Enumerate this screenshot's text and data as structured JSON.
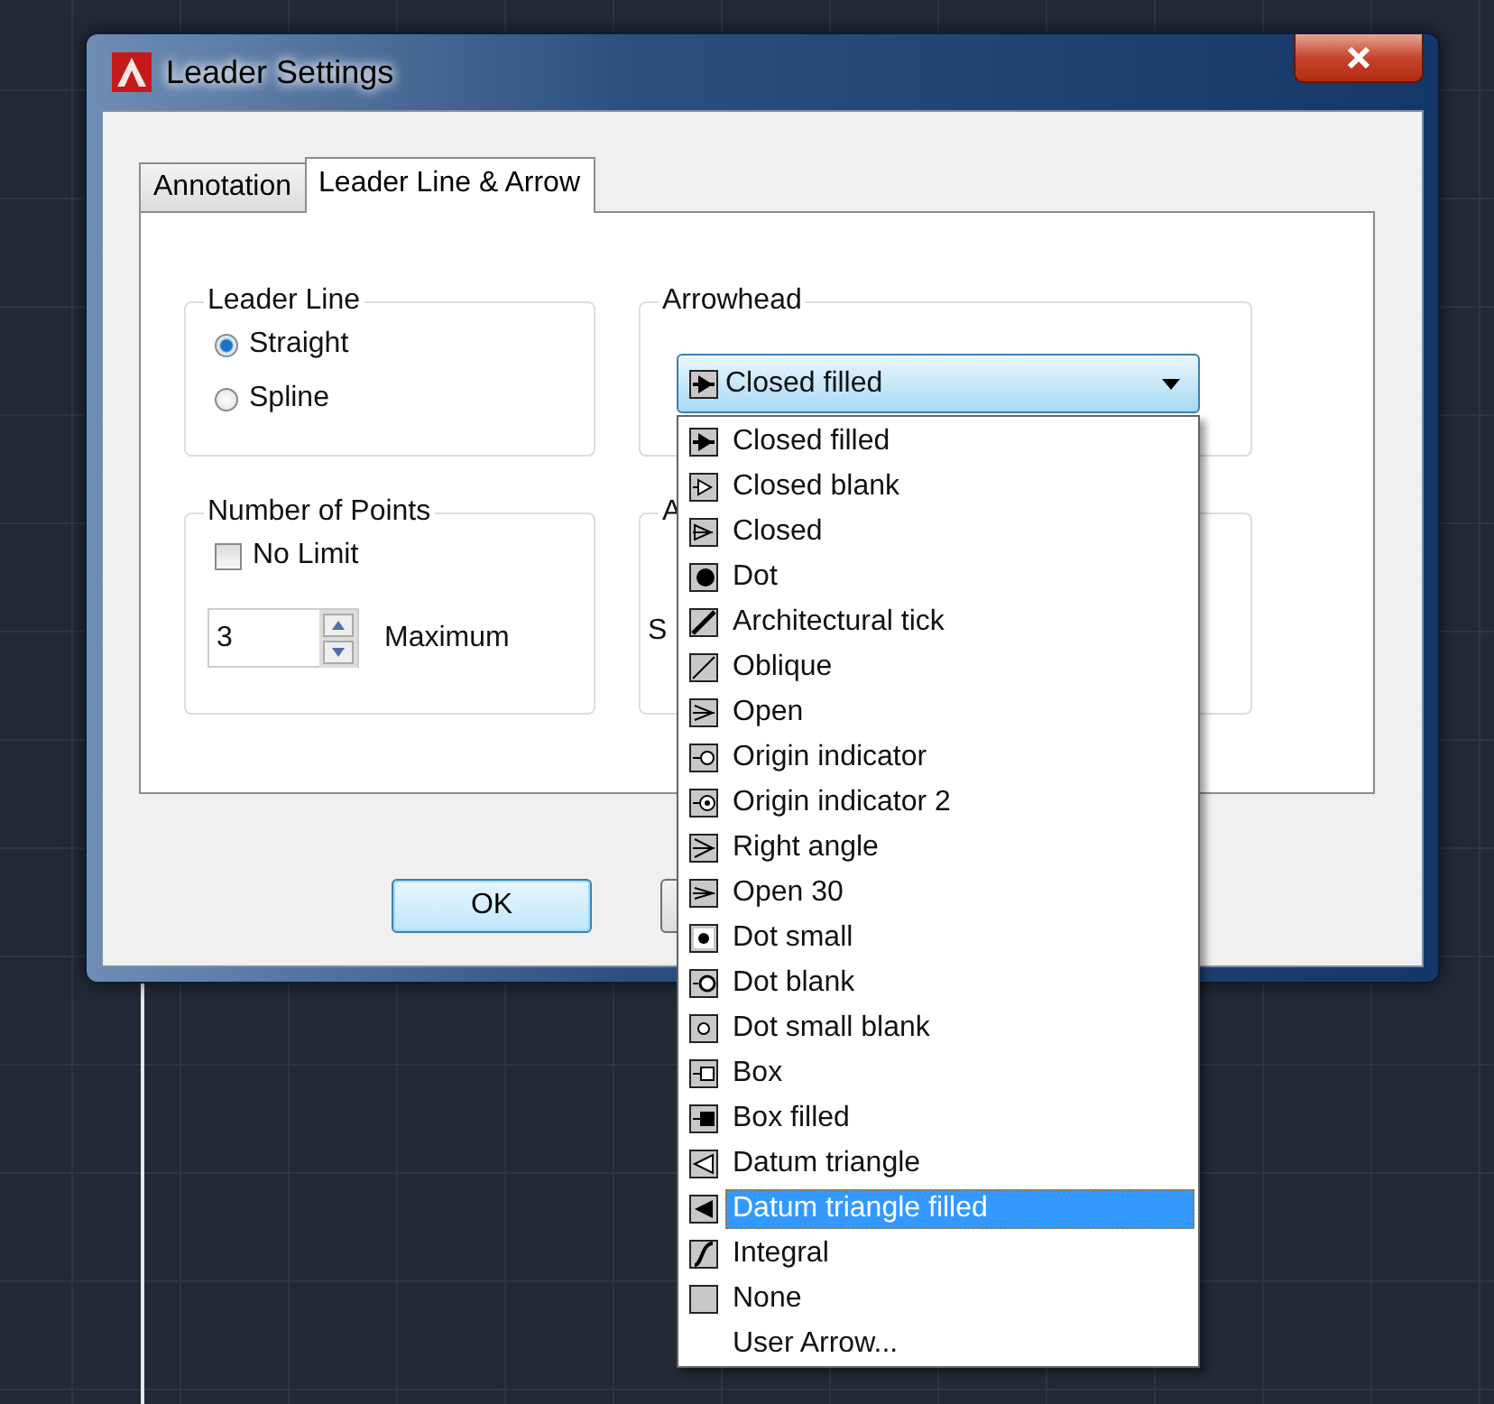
{
  "window": {
    "title": "Leader Settings"
  },
  "tabs": [
    {
      "label": "Annotation",
      "selected": false
    },
    {
      "label": "Leader Line & Arrow",
      "selected": true
    }
  ],
  "leader_line": {
    "title": "Leader Line",
    "options": [
      {
        "label": "Straight",
        "selected": true
      },
      {
        "label": "Spline",
        "selected": false
      }
    ]
  },
  "number_of_points": {
    "title": "Number of Points",
    "no_limit": {
      "label": "No Limit",
      "checked": false
    },
    "maximum": {
      "value": "3",
      "label": "Maximum"
    }
  },
  "arrowhead": {
    "title": "Arrowhead",
    "combo": {
      "value": "Closed filled",
      "kind": "filledarrow"
    },
    "options": [
      {
        "label": "Closed filled",
        "kind": "filledarrow",
        "selected": false
      },
      {
        "label": "Closed blank",
        "kind": "blankarrow",
        "selected": false
      },
      {
        "label": "Closed",
        "kind": "closedarrow",
        "selected": false
      },
      {
        "label": "Dot",
        "kind": "dot",
        "selected": false
      },
      {
        "label": "Architectural tick",
        "kind": "tick",
        "selected": false
      },
      {
        "label": "Oblique",
        "kind": "oblique",
        "selected": false
      },
      {
        "label": "Open",
        "kind": "open",
        "selected": false
      },
      {
        "label": "Origin indicator",
        "kind": "origin",
        "selected": false
      },
      {
        "label": "Origin indicator 2",
        "kind": "origin2",
        "selected": false
      },
      {
        "label": "Right angle",
        "kind": "rightangle",
        "selected": false
      },
      {
        "label": "Open 30",
        "kind": "open30",
        "selected": false
      },
      {
        "label": "Dot small",
        "kind": "dotsmall",
        "selected": false
      },
      {
        "label": "Dot blank",
        "kind": "dotblank",
        "selected": false
      },
      {
        "label": "Dot small blank",
        "kind": "dotsmallblank",
        "selected": false
      },
      {
        "label": "Box",
        "kind": "box",
        "selected": false
      },
      {
        "label": "Box filled",
        "kind": "boxfilled",
        "selected": false
      },
      {
        "label": "Datum triangle",
        "kind": "datum",
        "selected": false
      },
      {
        "label": "Datum triangle filled",
        "kind": "datumfilled",
        "selected": true
      },
      {
        "label": "Integral",
        "kind": "integral",
        "selected": false
      },
      {
        "label": "None",
        "kind": "none",
        "selected": false
      },
      {
        "label": "User Arrow...",
        "kind": "user",
        "selected": false
      }
    ]
  },
  "covered_group": {
    "title": "A",
    "label": "S"
  },
  "buttons": [
    {
      "label": "OK"
    }
  ]
}
